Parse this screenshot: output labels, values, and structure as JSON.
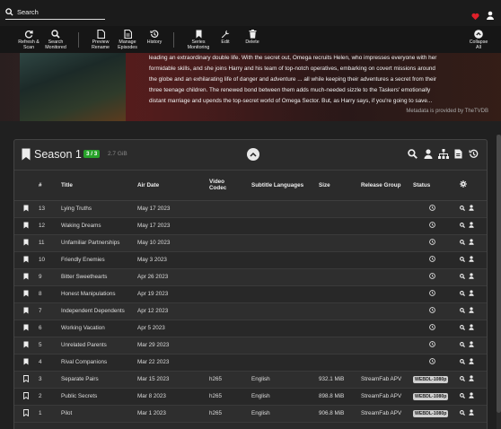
{
  "nav": {
    "search_placeholder": "Search",
    "heart_color": "#e0202a"
  },
  "toolbar": {
    "buttons": [
      {
        "label1": "Refresh &",
        "label2": "Scan",
        "icon": "refresh-icon"
      },
      {
        "label1": "Search",
        "label2": "Monitored",
        "icon": "search-icon"
      },
      {
        "label1": "Preview",
        "label2": "Rename",
        "icon": "file-icon"
      },
      {
        "label1": "Manage",
        "label2": "Episodes",
        "icon": "file-list-icon"
      },
      {
        "label1": "History",
        "label2": "",
        "icon": "history-icon"
      },
      {
        "label1": "Series",
        "label2": "Monitoring",
        "icon": "bookmark-icon"
      },
      {
        "label1": "Edit",
        "label2": "",
        "icon": "wrench-icon"
      },
      {
        "label1": "Delete",
        "label2": "",
        "icon": "trash-icon"
      },
      {
        "label1": "Collapse",
        "label2": "All",
        "icon": "chevron-up-circle-icon"
      }
    ]
  },
  "overview": {
    "lines": [
      "leading an extraordinary double life. With the secret out, Omega recruits Helen, who impresses everyone with her",
      "formidable skills, and she joins Harry and his team of top-notch operatives, embarking on covert missions around",
      "the globe and an exhilarating life of danger and adventure ... all while keeping their adventures a secret from their",
      "three teenage children. The renewed bond between them adds much-needed sizzle to the Taskers' emotionally",
      "distant marriage and upends the top-secret world of Omega Sector. But, as Harry says, if you're going to save..."
    ],
    "metadata_note": "Metadata is provided by TheTVDB"
  },
  "season": {
    "title": "Season 1",
    "episode_count": "3 / 3",
    "size": "2.7 GiB",
    "count_color": "#27a22a",
    "columns": [
      "#",
      "Title",
      "Air Date",
      "Video Codec",
      "Subtitle Languages",
      "Size",
      "Release Group",
      "Status"
    ],
    "codec_line1": "Video",
    "codec_line2": "Codec",
    "episodes": [
      {
        "num": "13",
        "title": "Lying Truths",
        "air": "May 17 2023",
        "codec": "",
        "subs": "",
        "size": "",
        "group": "",
        "badge": "",
        "monitored": true
      },
      {
        "num": "12",
        "title": "Waking Dreams",
        "air": "May 17 2023",
        "codec": "",
        "subs": "",
        "size": "",
        "group": "",
        "badge": "",
        "monitored": true
      },
      {
        "num": "11",
        "title": "Unfamiliar Partnerships",
        "air": "May 10 2023",
        "codec": "",
        "subs": "",
        "size": "",
        "group": "",
        "badge": "",
        "monitored": true
      },
      {
        "num": "10",
        "title": "Friendly Enemies",
        "air": "May 3 2023",
        "codec": "",
        "subs": "",
        "size": "",
        "group": "",
        "badge": "",
        "monitored": true
      },
      {
        "num": "9",
        "title": "Bitter Sweethearts",
        "air": "Apr 26 2023",
        "codec": "",
        "subs": "",
        "size": "",
        "group": "",
        "badge": "",
        "monitored": true
      },
      {
        "num": "8",
        "title": "Honest Manipulations",
        "air": "Apr 19 2023",
        "codec": "",
        "subs": "",
        "size": "",
        "group": "",
        "badge": "",
        "monitored": true
      },
      {
        "num": "7",
        "title": "Independent Dependents",
        "air": "Apr 12 2023",
        "codec": "",
        "subs": "",
        "size": "",
        "group": "",
        "badge": "",
        "monitored": true
      },
      {
        "num": "6",
        "title": "Working Vacation",
        "air": "Apr 5 2023",
        "codec": "",
        "subs": "",
        "size": "",
        "group": "",
        "badge": "",
        "monitored": true
      },
      {
        "num": "5",
        "title": "Unrelated Parents",
        "air": "Mar 29 2023",
        "codec": "",
        "subs": "",
        "size": "",
        "group": "",
        "badge": "",
        "monitored": true
      },
      {
        "num": "4",
        "title": "Rival Companions",
        "air": "Mar 22 2023",
        "codec": "",
        "subs": "",
        "size": "",
        "group": "",
        "badge": "",
        "monitored": true
      },
      {
        "num": "3",
        "title": "Separate Pairs",
        "air": "Mar 15 2023",
        "codec": "h265",
        "subs": "English",
        "size": "932.1 MiB",
        "group": "StreamFab APV",
        "badge": "WEBDL-1080p",
        "monitored": false
      },
      {
        "num": "2",
        "title": "Public Secrets",
        "air": "Mar 8 2023",
        "codec": "h265",
        "subs": "English",
        "size": "898.8 MiB",
        "group": "StreamFab APV",
        "badge": "WEBDL-1080p",
        "monitored": false
      },
      {
        "num": "1",
        "title": "Pilot",
        "air": "Mar 1 2023",
        "codec": "h265",
        "subs": "English",
        "size": "906.8 MiB",
        "group": "StreamFab APV",
        "badge": "WEBDL-1080p",
        "monitored": false
      }
    ]
  }
}
